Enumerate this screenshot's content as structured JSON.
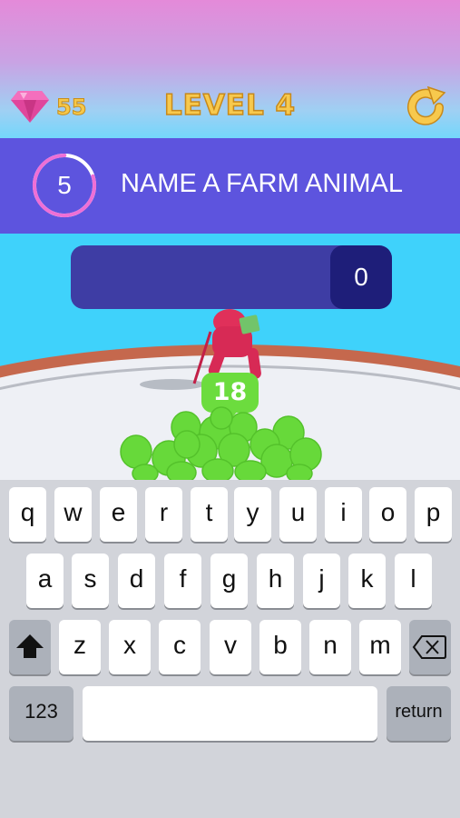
{
  "hud": {
    "gems": "55",
    "level": "LEVEL 4",
    "gem_icon": "gem-icon",
    "restart_icon": "restart-icon"
  },
  "question": {
    "timer": "5",
    "timer_progress": 0.2,
    "prompt": "NAME A FARM ANIMAL"
  },
  "answer": {
    "text": "",
    "count": "0"
  },
  "crowd": {
    "count": "18"
  },
  "keyboard": {
    "row1": [
      "q",
      "w",
      "e",
      "r",
      "t",
      "y",
      "u",
      "i",
      "o",
      "p"
    ],
    "row2": [
      "a",
      "s",
      "d",
      "f",
      "g",
      "h",
      "j",
      "k",
      "l"
    ],
    "row3": [
      "z",
      "x",
      "c",
      "v",
      "b",
      "n",
      "m"
    ],
    "numbers_label": "123",
    "return_label": "return",
    "shift_icon": "shift-icon",
    "backspace_icon": "backspace-icon"
  },
  "colors": {
    "banner": "#5d54de",
    "gold": "#f7c94d",
    "crowd_green": "#6cdc3e",
    "player_red": "#e0305a"
  }
}
